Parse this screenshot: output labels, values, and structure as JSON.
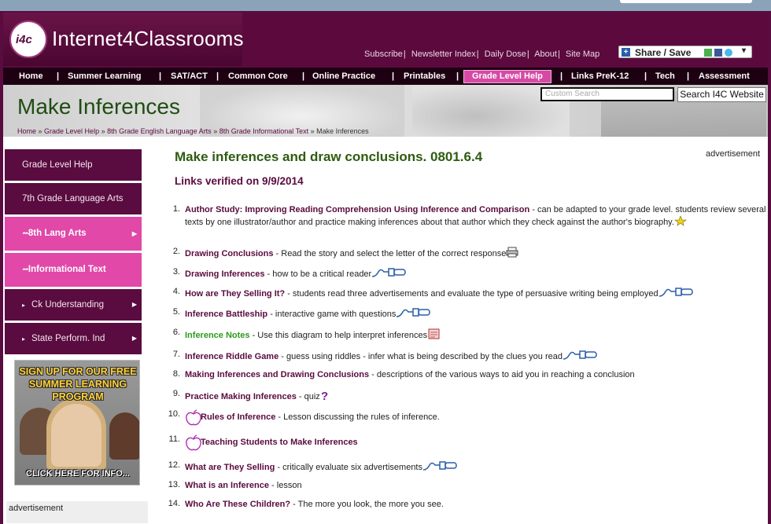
{
  "site": {
    "logo_mark": "i4c",
    "logo_text": "Internet4Classrooms",
    "top_links": [
      "Subscribe",
      "Newsletter Index",
      "Daily Dose",
      "About",
      "Site Map"
    ],
    "share_label": "Share / Save"
  },
  "nav": {
    "items": [
      "Home",
      "Summer Learning",
      "SAT/ACT",
      "Common Core",
      "Online Practice",
      "Printables",
      "Grade Level Help",
      "Links PreK-12",
      "Tech",
      "Assessment"
    ],
    "active": "Grade Level Help"
  },
  "banner": {
    "title": "Make Inferences",
    "search_placeholder": "Custom Search",
    "search_button": "Search I4C Website",
    "breadcrumb": [
      "Home",
      "Grade Level Help",
      "8th Grade English Language Arts",
      "8th Grade Informational Text",
      "Make Inferences"
    ]
  },
  "sidebar": {
    "items": [
      {
        "label": "Grade Level Help",
        "style": "dark"
      },
      {
        "label": "7th Grade Language Arts",
        "style": "dark"
      },
      {
        "label": "8th Lang Arts",
        "style": "pink"
      },
      {
        "label": "Informational Text",
        "style": "pink"
      },
      {
        "label": "Ck Understanding",
        "style": "dark"
      },
      {
        "label": "State Perform. Ind",
        "style": "dark"
      }
    ],
    "promo": {
      "headline": "SIGN UP FOR OUR FREE SUMMER LEARNING PROGRAM",
      "cta": "CLICK HERE FOR INFO..."
    },
    "ad_label": "advertisement"
  },
  "main": {
    "title": "Make inferences and draw conclusions. 0801.6.4",
    "verified": "Links verified on 9/9/2014",
    "ad_label": "advertisement",
    "items": [
      {
        "n": "1.",
        "link": "Author Study: Improving Reading Comprehension Using Inference and Comparison",
        "desc": " - can be adapted to your grade level.  students review several texts by one illustrator/author and practice making inferences about that author which they check against the author's biography.",
        "icon": "star"
      },
      {
        "n": "2.",
        "link": "Drawing Conclusions",
        "desc": " - Read the story and select the letter of the correct response",
        "icon": "printer"
      },
      {
        "n": "3.",
        "link": "Drawing  Inferences",
        "desc": " - how to be a critical reader",
        "icon": "plug"
      },
      {
        "n": "4.",
        "link": "How are They Selling It?",
        "desc": " - students read three advertisements and evaluate the type of persuasive writing being employed",
        "icon": "plug"
      },
      {
        "n": "5.",
        "link": "Inference  Battleship",
        "desc": " - interactive game with questions",
        "icon": "plug"
      },
      {
        "n": "6.",
        "link": "Inference  Notes",
        "desc": " - Use this diagram to help interpret inferences",
        "icon": "notes",
        "green": true
      },
      {
        "n": "7.",
        "link": "Inference  Riddle Game",
        "desc": " - guess using riddles - infer what is being described by the clues you read",
        "icon": "plug"
      },
      {
        "n": "8.",
        "link": "Making Inferences and Drawing Conclusions",
        "desc": "    - descriptions of the various ways to aid you in reaching a conclusion",
        "icon": ""
      },
      {
        "n": "9.",
        "link": "Practice Making Inferences",
        "desc": " - quiz",
        "icon": "question"
      },
      {
        "n": "10.",
        "link": "Rules of Inference",
        "desc": " - Lesson discussing the rules of inference.",
        "icon": "apple"
      },
      {
        "n": "11.",
        "link": "Teaching  Students to Make Inferences",
        "desc": "",
        "icon": "apple"
      },
      {
        "n": "12.",
        "link": "What are They Selling",
        "desc": " - critically evaluate six advertisements",
        "icon": "plug"
      },
      {
        "n": "13.",
        "link": "What is an Inference",
        "desc": " - lesson",
        "icon": ""
      },
      {
        "n": "14.",
        "link": "Who Are These Children?",
        "desc": " - The more you look, the more you see.",
        "icon": ""
      }
    ]
  },
  "colors": {
    "brand": "#5a0b3f",
    "accent_pink": "#e148a8",
    "title_green": "#2e5c10",
    "link_green": "#2c9a1e"
  }
}
